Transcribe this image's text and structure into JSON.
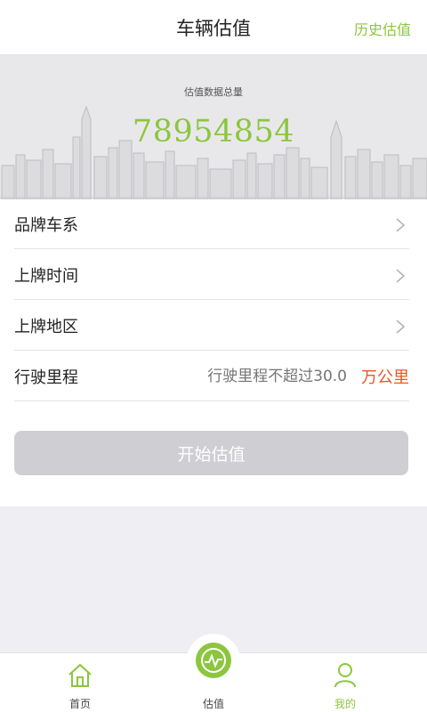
{
  "header": {
    "title": "车辆估值",
    "history_label": "历史估值"
  },
  "banner": {
    "label": "估值数据总量",
    "count": "78954854"
  },
  "form": {
    "brand_label": "品牌车系",
    "reg_time_label": "上牌时间",
    "reg_region_label": "上牌地区",
    "mileage_label": "行驶里程",
    "mileage_placeholder": "行驶里程不超过30.0",
    "mileage_unit": "万公里",
    "start_label": "开始估值"
  },
  "tabbar": {
    "home_label": "首页",
    "valuation_label": "估值",
    "mine_label": "我的"
  },
  "colors": {
    "accent": "#8cc63f",
    "unit": "#e8562a",
    "button_disabled": "#cfcfd3"
  }
}
